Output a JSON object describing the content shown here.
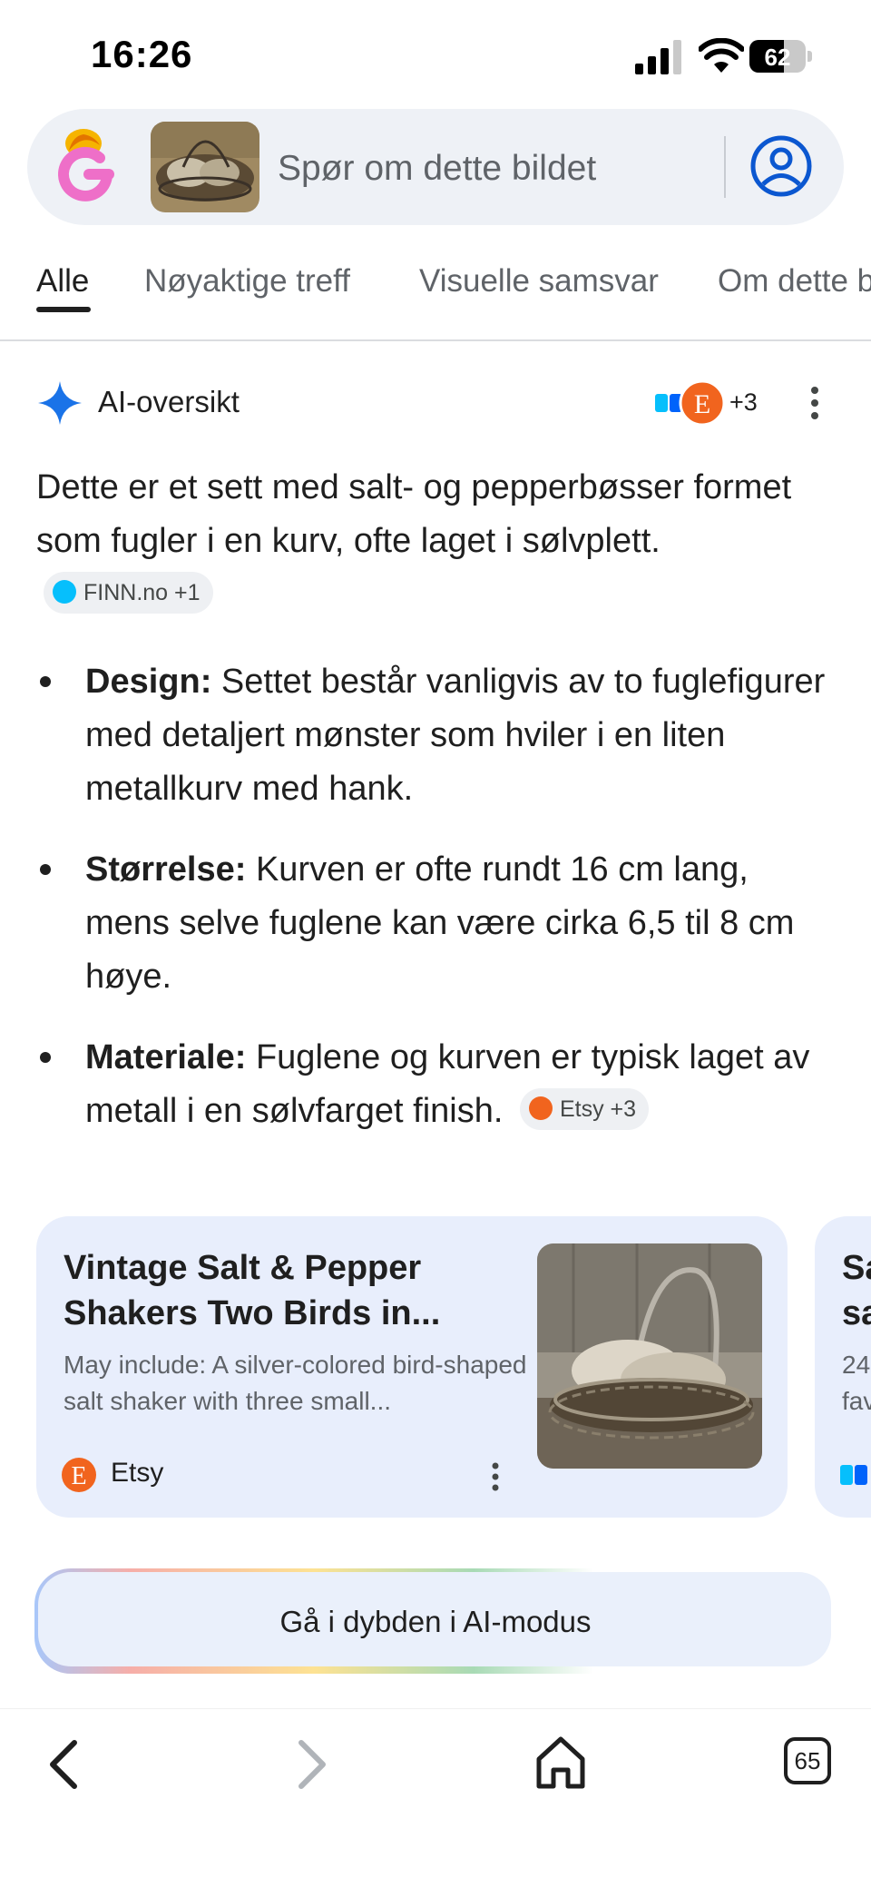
{
  "status_bar": {
    "time": "16:26",
    "battery": "62",
    "battery_level": 0.62
  },
  "search": {
    "placeholder": "Spør om dette bildet"
  },
  "tabs": [
    {
      "label": "Alle",
      "active": true
    },
    {
      "label": "Nøyaktige treff"
    },
    {
      "label": "Visuelle samsvar"
    },
    {
      "label": "Om dette b"
    }
  ],
  "ai_overview": {
    "title": "AI-oversikt",
    "source_count": "+3",
    "intro": "Dette er et sett med salt- og pepperbøsser formet som fugler i en kurv, ofte laget i sølvplett.",
    "intro_chip": "FINN.no +1",
    "bullets": [
      {
        "label": "Design:",
        "text": " Settet består vanligvis av to fuglefigurer med detaljert mønster som hviler i en liten metallkurv med hank."
      },
      {
        "label": "Størrelse:",
        "text": " Kurven er ofte rundt 16 cm lang, mens selve fuglene kan være cirka 6,5 til 8 cm høye."
      },
      {
        "label": "Materiale:",
        "text": " Fuglene og kurven er typisk laget av metall i en sølvfarget finish.",
        "chip": "Etsy +3"
      }
    ]
  },
  "cards": [
    {
      "title": "Vintage Salt & Pepper Shakers Two Birds in...",
      "description": "May include: A silver-colored bird-shaped salt shaker with three small...",
      "source": "Etsy"
    },
    {
      "title": "Sa\nsa",
      "description": "24\nfav"
    }
  ],
  "ai_mode_button": "Gå i dybden i AI-modus",
  "nav": {
    "tab_count": "65"
  },
  "colors": {
    "accent_blue": "#0b57d0",
    "etsy_orange": "#f1641e",
    "finn_blue": "#06bffc",
    "card_bg": "#e8eefc"
  },
  "icons": [
    "google-lens-icon",
    "account-icon",
    "sparkle-icon",
    "more-vert-icon",
    "back-icon",
    "forward-icon",
    "home-icon",
    "tabs-icon"
  ]
}
